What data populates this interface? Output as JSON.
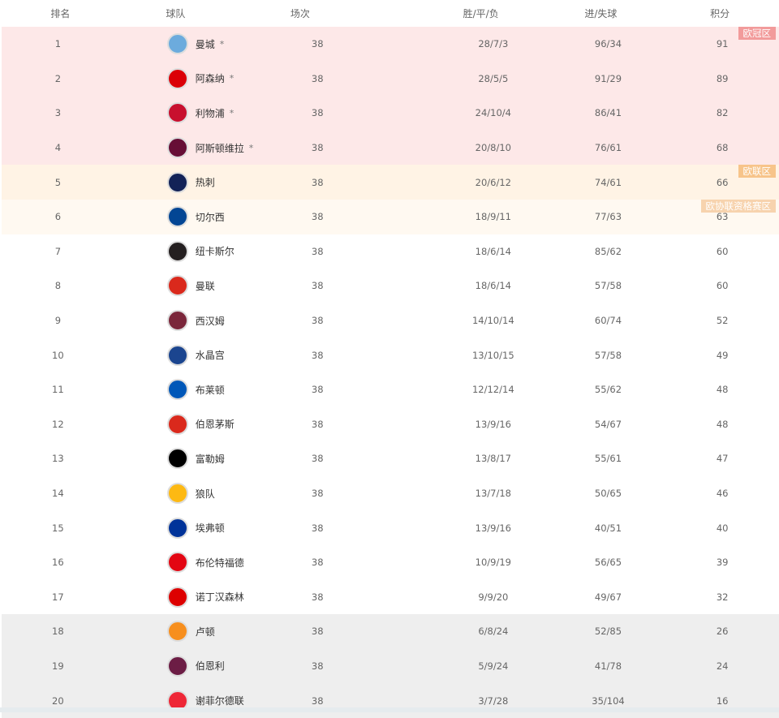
{
  "headers": {
    "rank": "排名",
    "team": "球队",
    "played": "场次",
    "wdl": "胜/平/负",
    "goals": "进/失球",
    "points": "积分"
  },
  "zones": {
    "cl": "欧冠区",
    "el": "欧联区",
    "ecl": "欧协联资格赛区"
  },
  "colors": {
    "cl_bg": "#fde8e8",
    "el_bg": "#fff3e5",
    "ecl_bg": "#fff9f1",
    "rel_bg": "#eeeeee",
    "cl_tag": "#f29b9b",
    "el_tag": "#f7c48a"
  },
  "rows": [
    {
      "rank": "1",
      "team": "曼城",
      "star": "*",
      "played": "38",
      "wdl": "28/7/3",
      "goals": "96/34",
      "points": "91",
      "logo_color": "#6cabdd",
      "logo_icon": "man-city-crest-icon"
    },
    {
      "rank": "2",
      "team": "阿森纳",
      "star": "*",
      "played": "38",
      "wdl": "28/5/5",
      "goals": "91/29",
      "points": "89",
      "logo_color": "#db0007",
      "logo_icon": "arsenal-crest-icon"
    },
    {
      "rank": "3",
      "team": "利物浦",
      "star": "*",
      "played": "38",
      "wdl": "24/10/4",
      "goals": "86/41",
      "points": "82",
      "logo_color": "#c8102e",
      "logo_icon": "liverpool-crest-icon"
    },
    {
      "rank": "4",
      "team": "阿斯顿维拉",
      "star": "*",
      "played": "38",
      "wdl": "20/8/10",
      "goals": "76/61",
      "points": "68",
      "logo_color": "#670e36",
      "logo_icon": "aston-villa-crest-icon"
    },
    {
      "rank": "5",
      "team": "热刺",
      "star": "",
      "played": "38",
      "wdl": "20/6/12",
      "goals": "74/61",
      "points": "66",
      "logo_color": "#132257",
      "logo_icon": "tottenham-crest-icon"
    },
    {
      "rank": "6",
      "team": "切尔西",
      "star": "",
      "played": "38",
      "wdl": "18/9/11",
      "goals": "77/63",
      "points": "63",
      "logo_color": "#034694",
      "logo_icon": "chelsea-crest-icon"
    },
    {
      "rank": "7",
      "team": "纽卡斯尔",
      "star": "",
      "played": "38",
      "wdl": "18/6/14",
      "goals": "85/62",
      "points": "60",
      "logo_color": "#241f20",
      "logo_icon": "newcastle-crest-icon"
    },
    {
      "rank": "8",
      "team": "曼联",
      "star": "",
      "played": "38",
      "wdl": "18/6/14",
      "goals": "57/58",
      "points": "60",
      "logo_color": "#da291c",
      "logo_icon": "man-utd-crest-icon"
    },
    {
      "rank": "9",
      "team": "西汉姆",
      "star": "",
      "played": "38",
      "wdl": "14/10/14",
      "goals": "60/74",
      "points": "52",
      "logo_color": "#7a263a",
      "logo_icon": "west-ham-crest-icon"
    },
    {
      "rank": "10",
      "team": "水晶宫",
      "star": "",
      "played": "38",
      "wdl": "13/10/15",
      "goals": "57/58",
      "points": "49",
      "logo_color": "#1b458f",
      "logo_icon": "crystal-palace-crest-icon"
    },
    {
      "rank": "11",
      "team": "布莱顿",
      "star": "",
      "played": "38",
      "wdl": "12/12/14",
      "goals": "55/62",
      "points": "48",
      "logo_color": "#0057b8",
      "logo_icon": "brighton-crest-icon"
    },
    {
      "rank": "12",
      "team": "伯恩茅斯",
      "star": "",
      "played": "38",
      "wdl": "13/9/16",
      "goals": "54/67",
      "points": "48",
      "logo_color": "#da291c",
      "logo_icon": "bournemouth-crest-icon"
    },
    {
      "rank": "13",
      "team": "富勒姆",
      "star": "",
      "played": "38",
      "wdl": "13/8/17",
      "goals": "55/61",
      "points": "47",
      "logo_color": "#000000",
      "logo_icon": "fulham-crest-icon"
    },
    {
      "rank": "14",
      "team": "狼队",
      "star": "",
      "played": "38",
      "wdl": "13/7/18",
      "goals": "50/65",
      "points": "46",
      "logo_color": "#fdb913",
      "logo_icon": "wolves-crest-icon"
    },
    {
      "rank": "15",
      "team": "埃弗顿",
      "star": "",
      "played": "38",
      "wdl": "13/9/16",
      "goals": "40/51",
      "points": "40",
      "logo_color": "#003399",
      "logo_icon": "everton-crest-icon"
    },
    {
      "rank": "16",
      "team": "布伦特福德",
      "star": "",
      "played": "38",
      "wdl": "10/9/19",
      "goals": "56/65",
      "points": "39",
      "logo_color": "#e30613",
      "logo_icon": "brentford-crest-icon"
    },
    {
      "rank": "17",
      "team": "诺丁汉森林",
      "star": "",
      "played": "38",
      "wdl": "9/9/20",
      "goals": "49/67",
      "points": "32",
      "logo_color": "#dd0000",
      "logo_icon": "nottingham-forest-crest-icon"
    },
    {
      "rank": "18",
      "team": "卢顿",
      "star": "",
      "played": "38",
      "wdl": "6/8/24",
      "goals": "52/85",
      "points": "26",
      "logo_color": "#f78f1e",
      "logo_icon": "luton-crest-icon"
    },
    {
      "rank": "19",
      "team": "伯恩利",
      "star": "",
      "played": "38",
      "wdl": "5/9/24",
      "goals": "41/78",
      "points": "24",
      "logo_color": "#6c1d45",
      "logo_icon": "burnley-crest-icon"
    },
    {
      "rank": "20",
      "team": "谢菲尔德联",
      "star": "",
      "played": "38",
      "wdl": "3/7/28",
      "goals": "35/104",
      "points": "16",
      "logo_color": "#ee2737",
      "logo_icon": "sheffield-utd-crest-icon"
    }
  ]
}
